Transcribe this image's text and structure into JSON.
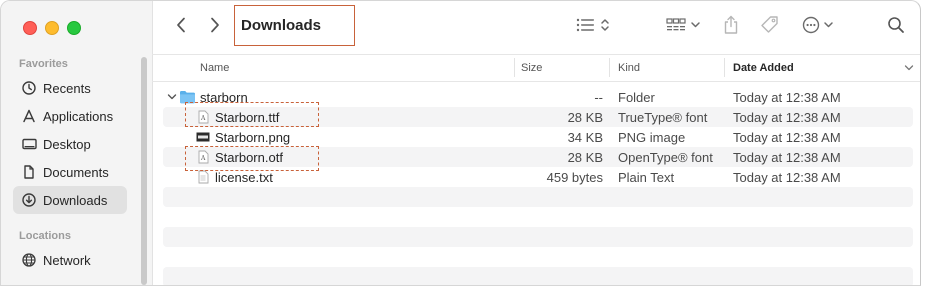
{
  "sidebar": {
    "favorites_title": "Favorites",
    "locations_title": "Locations",
    "items": [
      {
        "label": "Recents",
        "icon": "clock-icon"
      },
      {
        "label": "Applications",
        "icon": "applications-icon"
      },
      {
        "label": "Desktop",
        "icon": "desktop-icon"
      },
      {
        "label": "Documents",
        "icon": "document-icon"
      },
      {
        "label": "Downloads",
        "icon": "download-icon",
        "active": true
      }
    ],
    "location_items": [
      {
        "label": "Network",
        "icon": "globe-icon"
      }
    ]
  },
  "toolbar": {
    "title": "Downloads",
    "icons": [
      "back-icon",
      "forward-icon",
      "list-view-icon",
      "group-icon",
      "share-icon",
      "tag-icon",
      "more-icon",
      "search-icon"
    ]
  },
  "columns": {
    "name": "Name",
    "size": "Size",
    "kind": "Kind",
    "date": "Date Added"
  },
  "files": [
    {
      "name": "starborn",
      "size": "--",
      "kind": "Folder",
      "date": "Today at 12:38 AM",
      "icon": "folder-icon"
    },
    {
      "name": "Starborn.ttf",
      "size": "28 KB",
      "kind": "TrueType® font",
      "date": "Today at 12:38 AM",
      "icon": "font-file-icon"
    },
    {
      "name": "Starborn.png",
      "size": "34 KB",
      "kind": "PNG image",
      "date": "Today at 12:38 AM",
      "icon": "image-file-icon"
    },
    {
      "name": "Starborn.otf",
      "size": "28 KB",
      "kind": "OpenType® font",
      "date": "Today at 12:38 AM",
      "icon": "font-file-icon"
    },
    {
      "name": "license.txt",
      "size": "459 bytes",
      "kind": "Plain Text",
      "date": "Today at 12:38 AM",
      "icon": "text-file-icon"
    }
  ],
  "colors": {
    "highlight": "#c8623a",
    "folder": "#4fa3e0"
  }
}
